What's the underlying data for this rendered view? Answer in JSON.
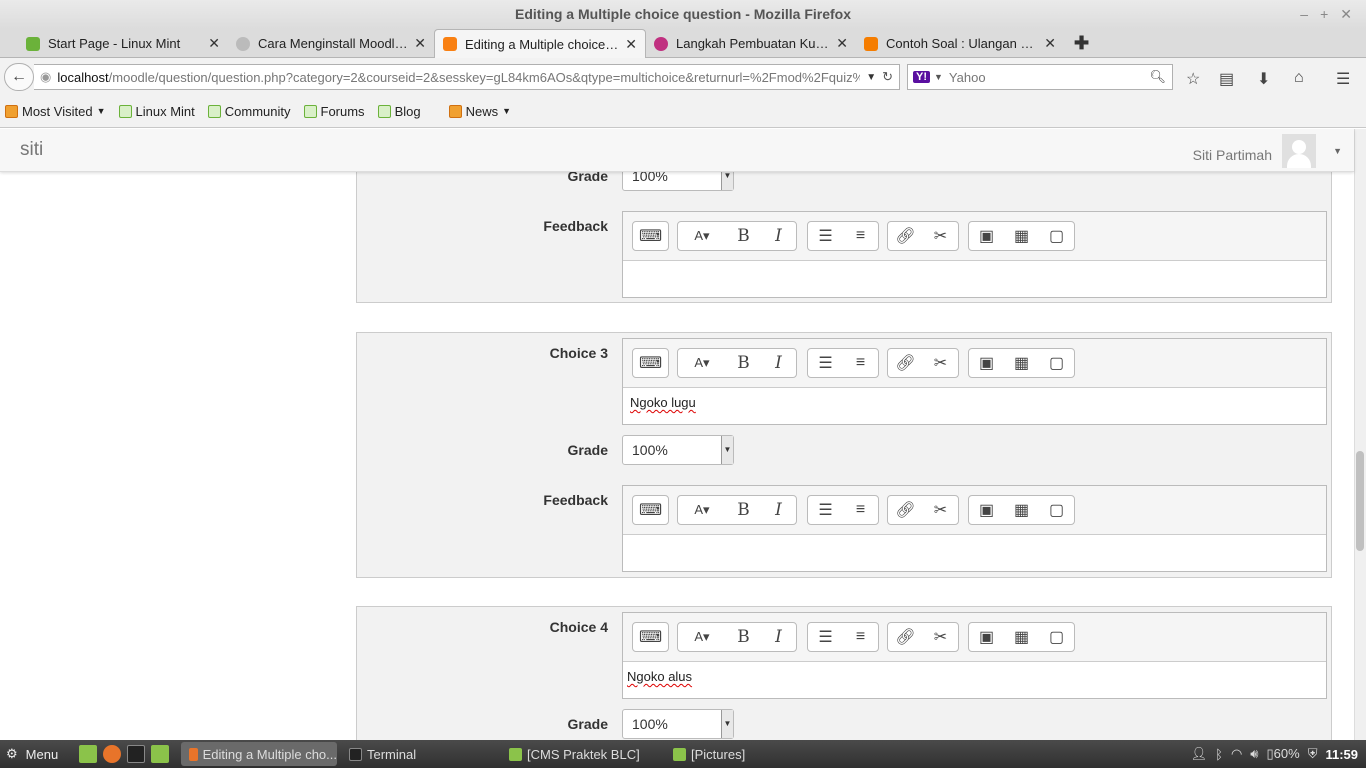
{
  "window": {
    "title": "Editing a Multiple choice question - Mozilla Firefox"
  },
  "tabs": [
    {
      "label": "Start Page - Linux Mint",
      "color": "#6bb23a"
    },
    {
      "label": "Cara Menginstall Moodle...",
      "color": "#999999"
    },
    {
      "label": "Editing a Multiple choice ...",
      "color": "#f98012"
    },
    {
      "label": "Langkah Pembuatan Kuis...",
      "color": "#c03080"
    },
    {
      "label": "Contoh Soal : Ulangan Se...",
      "color": "#f57d00"
    }
  ],
  "nav": {
    "url_host": "localhost",
    "url_path": "/moodle/question/question.php?category=2&courseid=2&sesskey=gL84km6AOs&qtype=multichoice&returnurl=%2Fmod%2Fquiz%2Fec",
    "search_placeholder": "Yahoo"
  },
  "bookmarks": {
    "most_visited": "Most Visited",
    "linux_mint": "Linux Mint",
    "community": "Community",
    "forums": "Forums",
    "blog": "Blog",
    "news": "News"
  },
  "moodle": {
    "brand": "siti",
    "user_name": "Siti Partimah"
  },
  "form": {
    "grade_label": "Grade",
    "feedback_label": "Feedback",
    "top_grade": "100%",
    "choice3": {
      "label": "Choice 3",
      "text": "Ngoko lugu",
      "grade": "100%"
    },
    "choice4": {
      "label": "Choice 4",
      "text": "Ngoko alus",
      "grade": "100%"
    }
  },
  "taskbar": {
    "menu": "Menu",
    "windows": [
      "Editing a Multiple cho...",
      "Terminal",
      "[CMS Praktek BLC]",
      "[Pictures]"
    ],
    "battery": "60%",
    "clock": "11:59"
  }
}
